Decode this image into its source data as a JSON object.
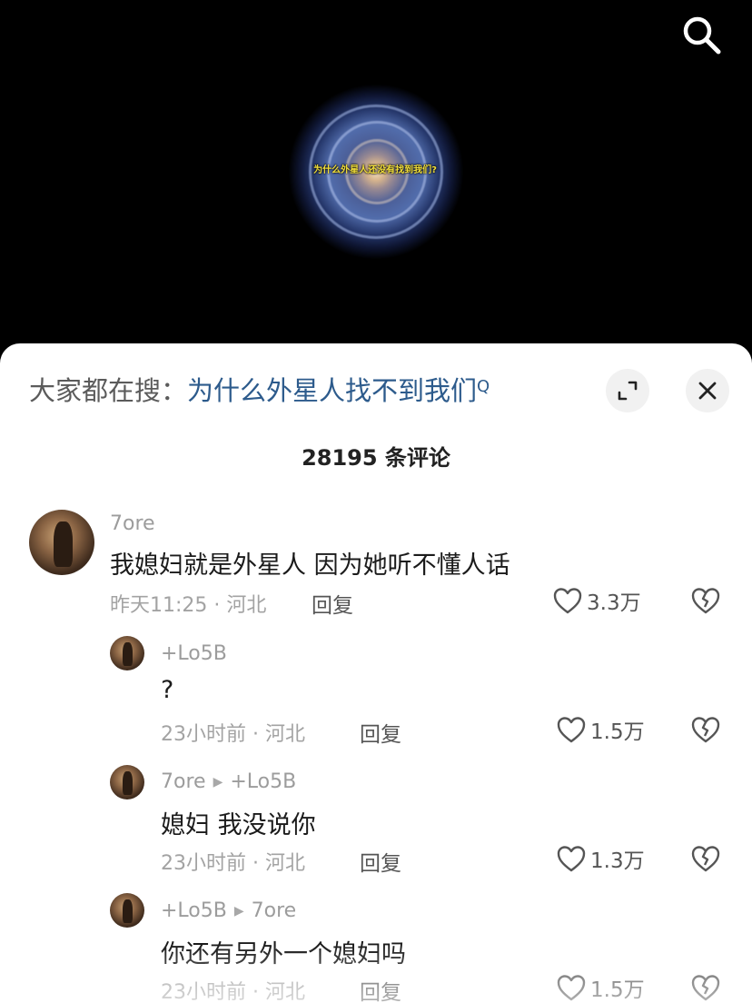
{
  "video": {
    "caption": "为什么外星人还没有找到我们?",
    "search_icon": "search-icon"
  },
  "sheet": {
    "hot_search_prefix": "大家都在搜：",
    "hot_search_term": "为什么外星人找不到我们",
    "hot_search_icon_glyph": "Q",
    "comment_count": "28195 条评论"
  },
  "comments": [
    {
      "user": "7ore",
      "text": "我媳妇就是外星人 因为她听不懂人话",
      "meta": "昨天11:25 · 河北",
      "reply_label": "回复",
      "likes": "3.3万"
    },
    {
      "user": "+Lo5B",
      "text": "?",
      "meta": "23小时前 · 河北",
      "reply_label": "回复",
      "likes": "1.5万"
    },
    {
      "user": "7ore",
      "reply_to": "+Lo5B",
      "text": "媳妇 我没说你",
      "meta": "23小时前 · 河北",
      "reply_label": "回复",
      "likes": "1.3万"
    },
    {
      "user": "+Lo5B",
      "reply_to": "7ore",
      "text": "你还有另外一个媳妇吗",
      "meta": "23小时前 · 河北",
      "reply_label": "回复",
      "likes": "1.5万"
    }
  ],
  "colors": {
    "link_blue": "#2d5b8c",
    "caption_yellow": "#f2df3a"
  }
}
